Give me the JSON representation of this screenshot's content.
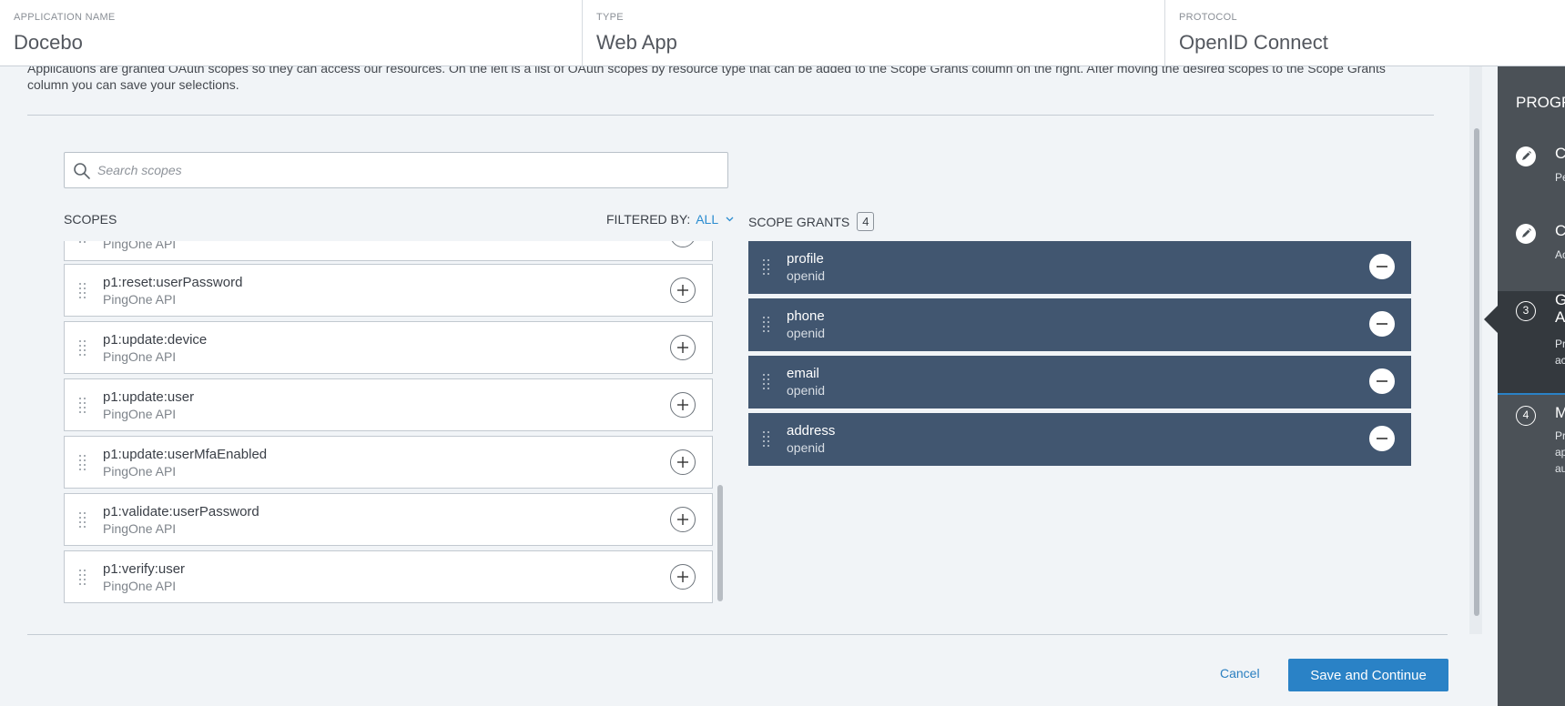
{
  "header": {
    "app_name_label": "APPLICATION NAME",
    "app_name_value": "Docebo",
    "type_label": "TYPE",
    "type_value": "Web App",
    "protocol_label": "PROTOCOL",
    "protocol_value": "OpenID Connect"
  },
  "description": "Applications are granted OAuth scopes so they can access our resources. On the left is a list of OAuth scopes by resource type that can be added to the Scope Grants column on the right. After moving the desired scopes to the Scope Grants column you can save your selections.",
  "search": {
    "placeholder": "Search scopes",
    "value": ""
  },
  "scopes": {
    "heading": "SCOPES",
    "filter_label": "FILTERED BY:",
    "filter_value": "ALL",
    "items": [
      {
        "name": "",
        "type": "PingOne API"
      },
      {
        "name": "p1:reset:userPassword",
        "type": "PingOne API"
      },
      {
        "name": "p1:update:device",
        "type": "PingOne API"
      },
      {
        "name": "p1:update:user",
        "type": "PingOne API"
      },
      {
        "name": "p1:update:userMfaEnabled",
        "type": "PingOne API"
      },
      {
        "name": "p1:validate:userPassword",
        "type": "PingOne API"
      },
      {
        "name": "p1:verify:user",
        "type": "PingOne API"
      }
    ]
  },
  "grants": {
    "heading": "SCOPE GRANTS",
    "count": "4",
    "items": [
      {
        "name": "profile",
        "type": "openid"
      },
      {
        "name": "phone",
        "type": "openid"
      },
      {
        "name": "email",
        "type": "openid"
      },
      {
        "name": "address",
        "type": "openid"
      }
    ]
  },
  "actions": {
    "cancel": "Cancel",
    "save": "Save and Continue"
  },
  "progress": {
    "title": "PROGR",
    "steps": [
      {
        "number": "",
        "title": "C",
        "sub": "Pe",
        "icon": "pencil-icon"
      },
      {
        "number": "",
        "title": "C",
        "sub": "Ac",
        "icon": "pencil-icon"
      },
      {
        "number": "3",
        "title": "G",
        "title2": "A",
        "sub": "Pr",
        "sub2": "ac",
        "icon": "number"
      },
      {
        "number": "4",
        "title": "M",
        "sub": "Pr",
        "sub2": "ap",
        "sub3": "au",
        "icon": "number"
      }
    ]
  },
  "colors": {
    "accent": "#2a82c6",
    "grant_bg": "#415670",
    "panel_bg": "#4b5157"
  }
}
